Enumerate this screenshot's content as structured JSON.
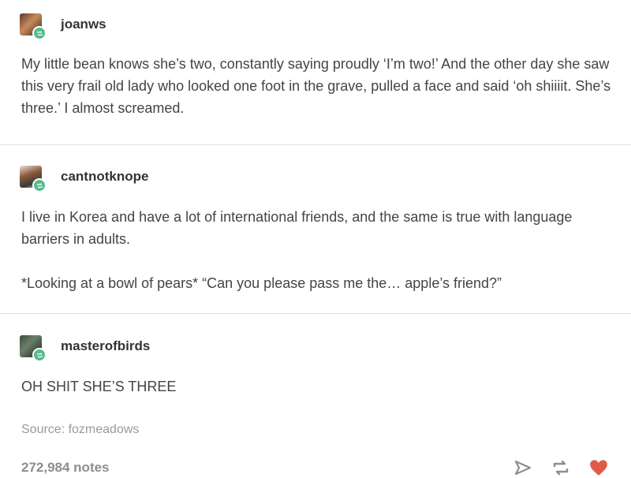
{
  "posts": [
    {
      "username": "joanws",
      "paragraphs": [
        "My little bean knows she’s two, constantly saying proudly ‘I’m two!’ And the other day she saw this very frail old lady who looked one foot in the grave, pulled a face and said ‘oh shiiiit. She’s three.’ I almost screamed."
      ]
    },
    {
      "username": "cantnotknope",
      "paragraphs": [
        "I live in Korea and have a lot of international friends, and the same is true with language barriers in adults.",
        "*Looking at a bowl of pears* “Can you please pass me the… apple’s friend?”"
      ]
    },
    {
      "username": "masterofbirds",
      "paragraphs": [
        "OH SHIT SHE’S THREE"
      ]
    }
  ],
  "source": "Source: fozmeadows",
  "notes": "272,984 notes",
  "icons": {
    "share": "paper-plane-icon",
    "reblog": "reblog-icon",
    "like": "heart-icon"
  },
  "colors": {
    "badge": "#56bc8a",
    "heart": "#e05a4a"
  }
}
